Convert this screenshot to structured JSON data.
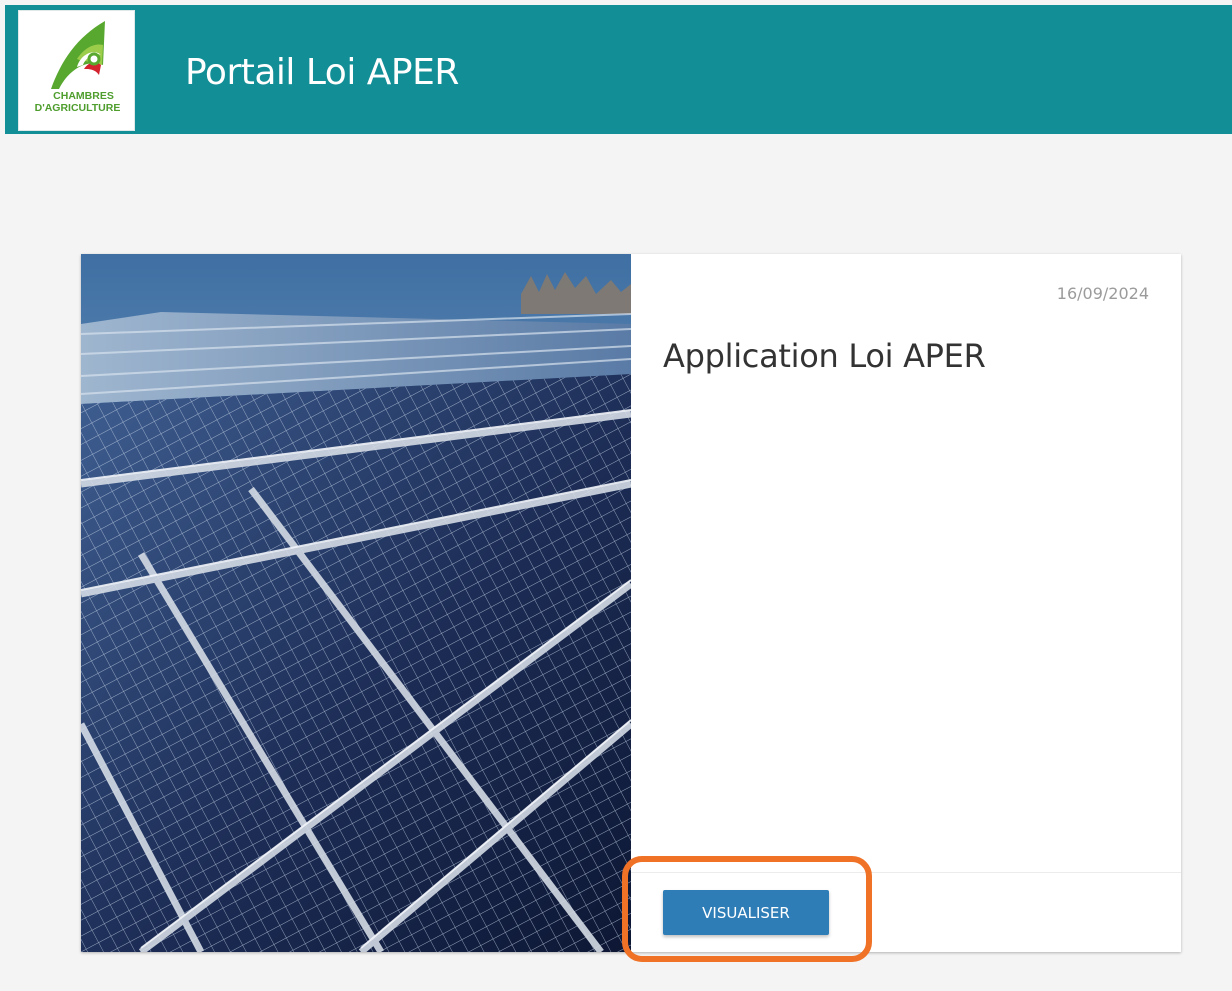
{
  "header": {
    "logo": {
      "icon": "chambres-agriculture-logo-icon",
      "line1": "CHAMBRES",
      "line2": "D'AGRICULTURE"
    },
    "title": "Portail Loi APER"
  },
  "card": {
    "image_icon": "solar-panels-photo",
    "date": "16/09/2024",
    "title": "Application Loi APER",
    "action_label": "VISUALISER"
  },
  "colors": {
    "header_bg": "#128e96",
    "button_bg": "#2e7db7",
    "highlight": "#f07226",
    "logo_green": "#4e9d2d"
  }
}
